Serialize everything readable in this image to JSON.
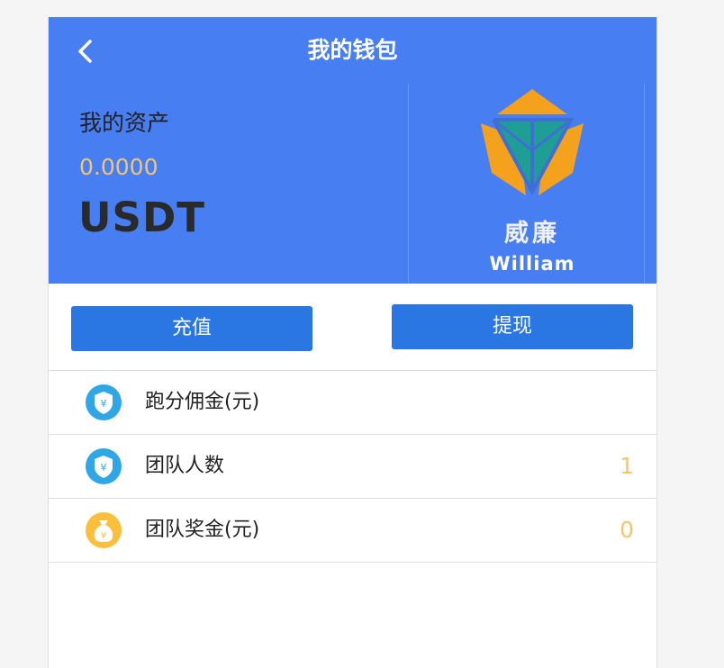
{
  "header": {
    "title": "我的钱包",
    "back_icon": "chevron-left-icon"
  },
  "asset": {
    "label": "我的资产",
    "value": "0.0000",
    "unit": "USDT"
  },
  "logo": {
    "cn": "威廉",
    "en": "William",
    "colors": {
      "orange": "#f4a21e",
      "teal": "#1f9e96",
      "blue": "#3f6fd4"
    }
  },
  "actions": {
    "recharge_label": "充值",
    "withdraw_label": "提现"
  },
  "list": [
    {
      "label": "跑分佣金(元)",
      "value": "",
      "icon": "yuan-shield-icon"
    },
    {
      "label": "团队人数",
      "value": "1",
      "icon": "yuan-shield-icon"
    },
    {
      "label": "团队奖金(元)",
      "value": "0",
      "icon": "money-bag-icon"
    }
  ],
  "colors": {
    "primary": "#477ef2",
    "button": "#2a76e3",
    "value": "#f6c46a"
  }
}
